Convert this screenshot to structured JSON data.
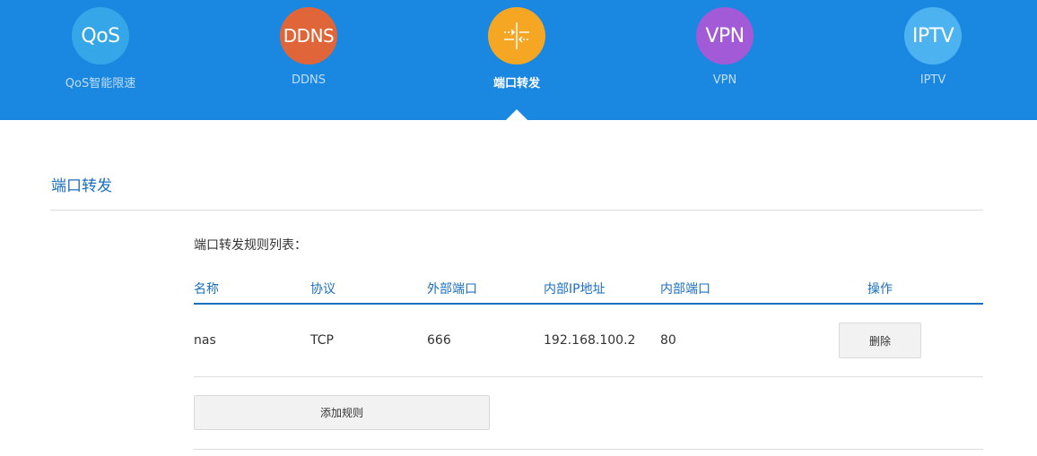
{
  "colors": {
    "header_bg": "#1a87e0",
    "accent_text": "#1a6fbf",
    "qos": "#35a6e8",
    "ddns": "#e0663a",
    "port_forward": "#f5a623",
    "vpn": "#a35ad6",
    "iptv": "#4db3f0"
  },
  "nav": {
    "items": [
      {
        "icon_text": "QoS",
        "label": "QoS智能限速",
        "icon": "qos-icon"
      },
      {
        "icon_text": "DDNS",
        "label": "DDNS",
        "icon": "ddns-icon"
      },
      {
        "icon_text": "",
        "label": "端口转发",
        "icon": "port-forward-icon",
        "active": true
      },
      {
        "icon_text": "VPN",
        "label": "VPN",
        "icon": "vpn-icon"
      },
      {
        "icon_text": "IPTV",
        "label": "IPTV",
        "icon": "iptv-icon"
      }
    ]
  },
  "section": {
    "title": "端口转发",
    "list_title": "端口转发规则列表："
  },
  "table": {
    "headers": [
      "名称",
      "协议",
      "外部端口",
      "内部IP地址",
      "内部端口",
      "操作"
    ],
    "rows": [
      {
        "name": "nas",
        "protocol": "TCP",
        "external_port": "666",
        "internal_ip": "192.168.100.2",
        "internal_port": "80",
        "action_label": "删除"
      }
    ]
  },
  "add_rule_label": "添加规则"
}
